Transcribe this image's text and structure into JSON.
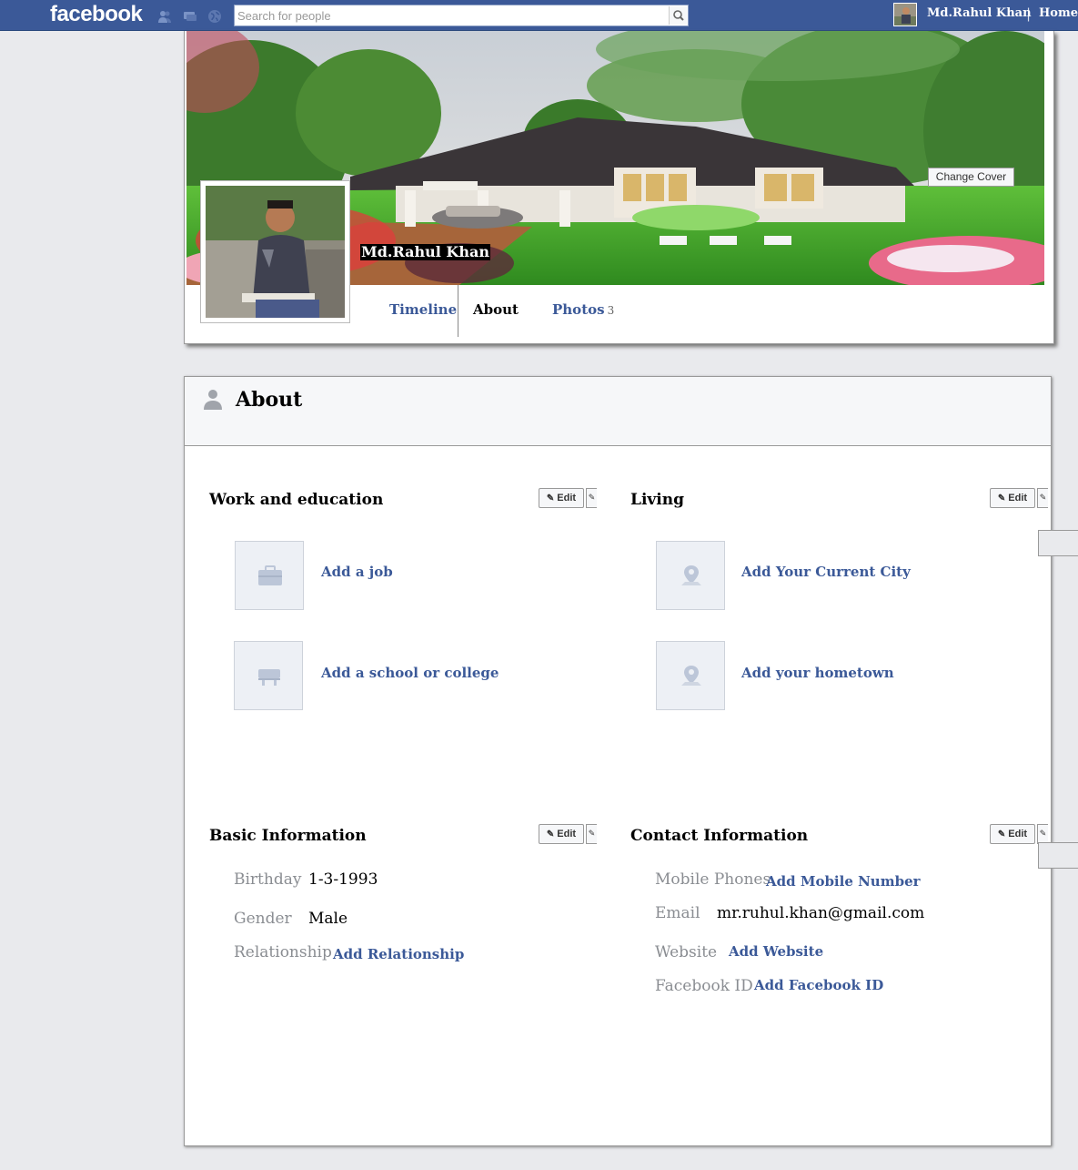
{
  "topbar": {
    "logo": "facebook",
    "search_placeholder": "Search for people",
    "username": "Md.Rahul Khan",
    "separator": "|",
    "home": "Home"
  },
  "profile": {
    "name": "Md.Rahul Khan",
    "change_cover": "Change Cover",
    "tabs": {
      "timeline": "Timeline",
      "about": "About",
      "photos": "Photos",
      "photos_count": "3"
    }
  },
  "about": {
    "title": "About",
    "edit_label": "Edit",
    "work": {
      "title": "Work and education",
      "add_job": "Add a job",
      "add_school": "Add a school or college"
    },
    "living": {
      "title": "Living",
      "add_city": "Add Your Current City",
      "add_hometown": "Add your hometown"
    },
    "basic": {
      "title": "Basic Information",
      "birthday_label": "Birthday",
      "birthday_value": "1-3-1993",
      "gender_label": "Gender",
      "gender_value": "Male",
      "relationship_label": "Relationship",
      "relationship_link": "Add Relationship"
    },
    "contact": {
      "title": "Contact Information",
      "mobile_label": "Mobile Phones",
      "mobile_link": "Add Mobile Number",
      "email_label": "Email",
      "email_value": "mr.ruhul.khan@gmail.com",
      "website_label": "Website",
      "website_link": "Add Website",
      "fbid_label": "Facebook ID",
      "fbid_link": "Add Facebook ID"
    }
  },
  "colors": {
    "brand": "#3b5998",
    "link": "#3b5998",
    "page_bg": "#e9eaed"
  }
}
